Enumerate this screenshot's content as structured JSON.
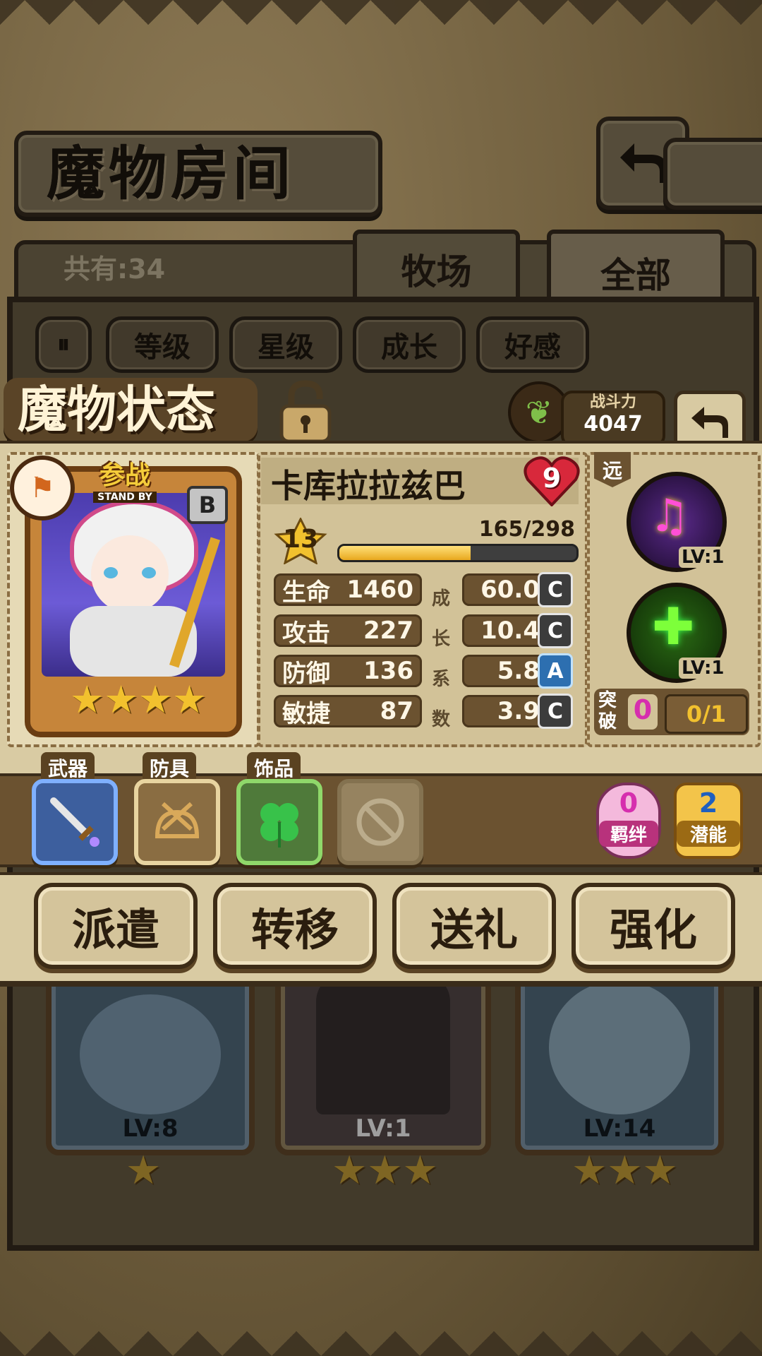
{
  "header": {
    "title": "魔物房间",
    "back_icon": "return-arrow-icon",
    "owned_label": "共有:34"
  },
  "tabs": [
    {
      "label": "牧场",
      "active": false
    },
    {
      "label": "全部",
      "active": true
    }
  ],
  "sort_filters": [
    "等级",
    "星级",
    "成长",
    "好感"
  ],
  "background_cards": [
    {
      "level": "LV:8",
      "stars": 1,
      "stars_text": "★"
    },
    {
      "level": "LV:1",
      "stars": 3,
      "stars_text": "★★★"
    },
    {
      "level": "LV:14",
      "stars": 3,
      "stars_text": "★★★"
    }
  ],
  "status": {
    "title": "魔物状态",
    "power_label": "战斗力",
    "power_value": "4047",
    "monster": {
      "name": "卡库拉拉兹巴",
      "rarity_rank": "B",
      "stand_by_label": "参战",
      "stand_by_sub": "STAND BY",
      "affection": "9",
      "level": "13",
      "exp_text": "165/298",
      "exp_fraction": 0.554,
      "stars_text": "★★★★",
      "range_tag": "远"
    },
    "stats": [
      {
        "label": "生命",
        "value": "1460",
        "growth": "60.0",
        "grade": "C"
      },
      {
        "label": "攻击",
        "value": "227",
        "growth": "10.4",
        "grade": "C"
      },
      {
        "label": "防御",
        "value": "136",
        "growth": "5.8",
        "grade": "A"
      },
      {
        "label": "敏捷",
        "value": "87",
        "growth": "3.9",
        "grade": "C"
      }
    ],
    "growth_coefficient_chars": [
      "成",
      "长",
      "系",
      "数"
    ],
    "skills": [
      {
        "icon": "music-note-icon",
        "level": "LV:1"
      },
      {
        "icon": "green-cross-heal-icon",
        "level": "LV:1"
      }
    ],
    "breakthrough": {
      "label_top": "突",
      "label_bottom": "破",
      "count": "0",
      "progress": "0/1"
    },
    "equipment": [
      {
        "label": "武器",
        "icon": "sword-icon"
      },
      {
        "label": "防具",
        "icon": "helmet-icon"
      },
      {
        "label": "饰品",
        "icon": "four-leaf-clover-icon"
      },
      {
        "label": "",
        "icon": "empty-slot-icon"
      }
    ],
    "bond": {
      "count": "0",
      "label": "羁绊"
    },
    "potential": {
      "count": "2",
      "label": "潜能"
    },
    "actions": [
      "派遣",
      "转移",
      "送礼",
      "强化"
    ]
  },
  "colors": {
    "panel": "#d9cba3",
    "frame_dark": "#3a2c1a",
    "gold": "#e8b72e",
    "affection_red": "#d8283b",
    "grade_a_blue": "#2d6fb0"
  }
}
